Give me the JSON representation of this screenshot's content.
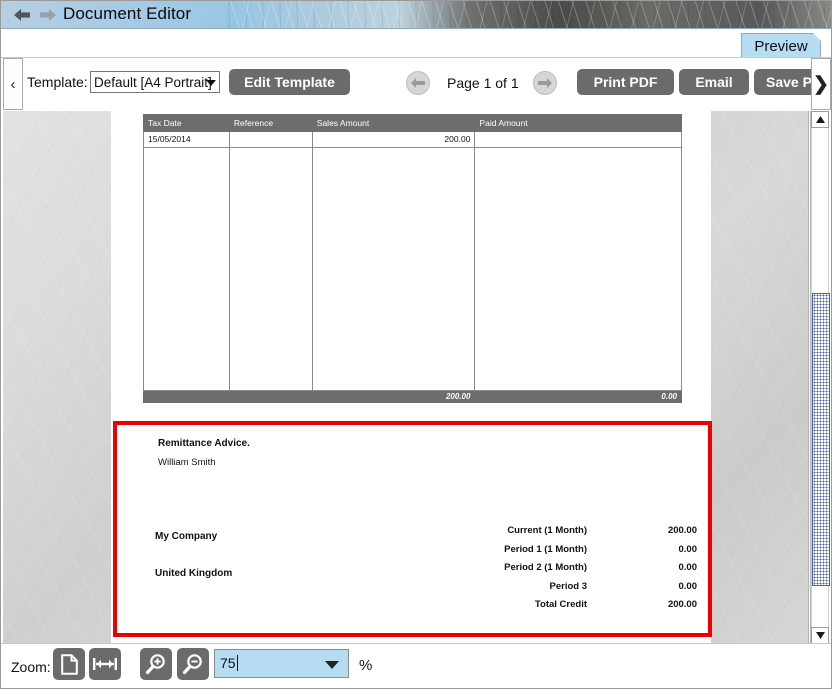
{
  "window": {
    "title": "Document Editor",
    "back_icon": "back-arrow-icon",
    "forward_icon": "forward-arrow-icon"
  },
  "tabs": {
    "preview_label": "Preview"
  },
  "toolbar": {
    "edge_left_icon": "‹",
    "edge_right_icon": "❯",
    "template_label": "Template:",
    "template_value": "Default [A4 Portrait]",
    "edit_template_label": "Edit Template",
    "page_label": "Page 1 of 1",
    "prev_page_icon": "prev-page-icon",
    "next_page_icon": "next-page-icon",
    "print_pdf_label": "Print PDF",
    "email_label": "Email",
    "save_pdf_label": "Save P"
  },
  "document": {
    "table": {
      "headers": [
        "Tax Date",
        "Reference",
        "Sales Amount",
        "Paid Amount"
      ],
      "rows": [
        [
          "15/05/2014",
          "",
          "200.00",
          ""
        ]
      ],
      "totals": [
        "",
        "",
        "200.00",
        "0.00"
      ]
    },
    "remittance": {
      "title": "Remittance Advice.",
      "customer_name": "William Smith",
      "company": "My Company",
      "country": "United Kingdom",
      "aging": [
        {
          "label": "Current (1 Month)",
          "value": "200.00"
        },
        {
          "label": "Period 1 (1 Month)",
          "value": "0.00"
        },
        {
          "label": "Period 2 (1 Month)",
          "value": "0.00"
        },
        {
          "label": "Period 3",
          "value": "0.00"
        },
        {
          "label": "Total Credit",
          "value": "200.00"
        }
      ]
    }
  },
  "zoombar": {
    "label": "Zoom:",
    "fit_page_icon": "fit-page-icon",
    "fit_width_icon": "fit-width-icon",
    "zoom_in_icon": "zoom-in-icon",
    "zoom_out_icon": "zoom-out-icon",
    "zoom_value": "75",
    "percent_label": "%"
  },
  "scrollbar": {
    "up_icon": "▲",
    "down_icon": "▼"
  },
  "colors": {
    "accent_blue": "#b6dcf2",
    "button_gray": "#6b6b6b",
    "highlight_red": "#ee0000",
    "table_header": "#6d6d6d"
  }
}
